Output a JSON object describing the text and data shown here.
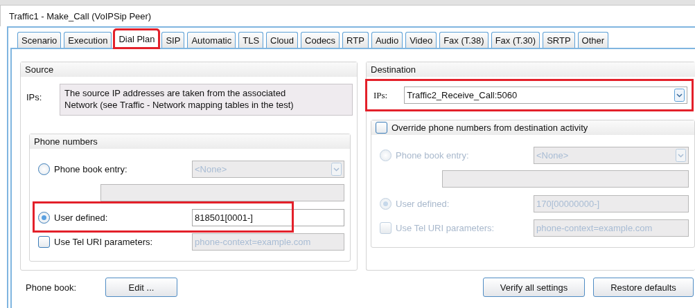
{
  "window": {
    "title": "Traffic1 - Make_Call (VoIPSip Peer)"
  },
  "tabs": [
    {
      "label": "Scenario",
      "selected": false,
      "highlighted": false
    },
    {
      "label": "Execution",
      "selected": false,
      "highlighted": false
    },
    {
      "label": "Dial Plan",
      "selected": true,
      "highlighted": true
    },
    {
      "label": "SIP",
      "selected": false,
      "highlighted": false
    },
    {
      "label": "Automatic",
      "selected": false,
      "highlighted": false
    },
    {
      "label": "TLS",
      "selected": false,
      "highlighted": false
    },
    {
      "label": "Cloud",
      "selected": false,
      "highlighted": false
    },
    {
      "label": "Codecs",
      "selected": false,
      "highlighted": false
    },
    {
      "label": "RTP",
      "selected": false,
      "highlighted": false
    },
    {
      "label": "Audio",
      "selected": false,
      "highlighted": false
    },
    {
      "label": "Video",
      "selected": false,
      "highlighted": false
    },
    {
      "label": "Fax (T.38)",
      "selected": false,
      "highlighted": false
    },
    {
      "label": "Fax (T.30)",
      "selected": false,
      "highlighted": false
    },
    {
      "label": "SRTP",
      "selected": false,
      "highlighted": false
    },
    {
      "label": "Other",
      "selected": false,
      "highlighted": false
    }
  ],
  "source": {
    "title": "Source",
    "ips_label": "IPs:",
    "ips_text": "The source IP addresses are taken from the associated Network (see Traffic - Network mapping tables in the test)",
    "phone_numbers": {
      "title": "Phone numbers",
      "rows": [
        {
          "kind": "radio-select",
          "label": "Phone book entry:",
          "selected": false,
          "value": "<None>",
          "disabled": true,
          "highlighted": false
        },
        {
          "kind": "blank-field",
          "disabled": true
        },
        {
          "kind": "radio-field",
          "label": "User defined:",
          "selected": true,
          "value": "818501[0001-]",
          "disabled": false,
          "highlighted": true
        },
        {
          "kind": "check-field",
          "label": "Use Tel URI parameters:",
          "checked": false,
          "value": "phone-context=example.com",
          "disabled": true,
          "label_disabled": false
        }
      ]
    }
  },
  "destination": {
    "title": "Destination",
    "ips": {
      "label": "IPs:",
      "value": "Traffic2_Receive_Call:5060",
      "highlighted": true
    },
    "override": {
      "label": "Override phone numbers from destination activity",
      "checked": false,
      "rows": [
        {
          "kind": "radio-select",
          "label": "Phone book entry:",
          "selected": false,
          "value": "<None>",
          "disabled": true,
          "highlighted": false
        },
        {
          "kind": "blank-field",
          "disabled": true
        },
        {
          "kind": "radio-field",
          "label": "User defined:",
          "selected": true,
          "value": "170[00000000-]",
          "disabled": true,
          "highlighted": false
        },
        {
          "kind": "check-field",
          "label": "Use Tel URI parameters:",
          "checked": false,
          "value": "phone-context=example.com",
          "disabled": true,
          "label_disabled": true
        }
      ]
    }
  },
  "footer": {
    "phone_book_label": "Phone book:",
    "edit_button": "Edit ...",
    "buttons": [
      "Verify all settings",
      "Restore defaults"
    ]
  }
}
